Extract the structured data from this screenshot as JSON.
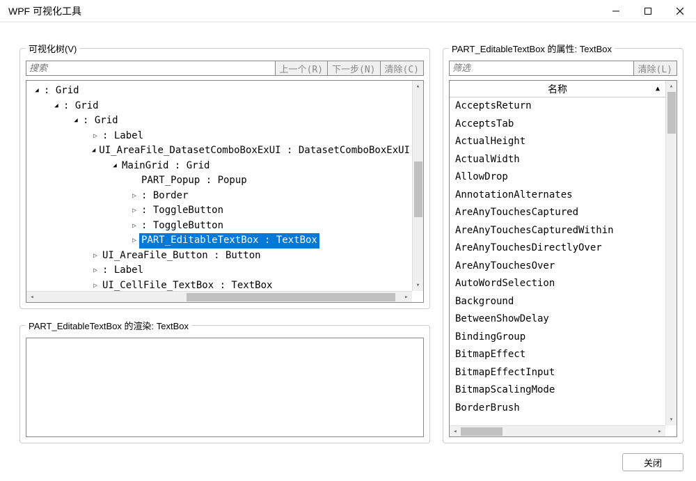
{
  "window": {
    "title": "WPF 可视化工具"
  },
  "left": {
    "tree_legend": "可视化树(V)",
    "search_placeholder": "搜索",
    "prev_label": "上一个(R)",
    "next_label": "下一步(N)",
    "clear_label": "清除(C)",
    "render_legend": "PART_EditableTextBox 的渲染: TextBox"
  },
  "tree": {
    "rows": [
      {
        "depth": 0,
        "arrow": "expanded",
        "text": " : Grid"
      },
      {
        "depth": 1,
        "arrow": "expanded",
        "text": " : Grid"
      },
      {
        "depth": 2,
        "arrow": "expanded",
        "text": " : Grid"
      },
      {
        "depth": 3,
        "arrow": "collapsed",
        "text": " : Label"
      },
      {
        "depth": 3,
        "arrow": "expanded",
        "text": "UI_AreaFile_DatasetComboBoxExUI : DatasetComboBoxExUI"
      },
      {
        "depth": 4,
        "arrow": "expanded",
        "text": "MainGrid : Grid"
      },
      {
        "depth": 5,
        "arrow": "none",
        "text": "PART_Popup : Popup"
      },
      {
        "depth": 5,
        "arrow": "collapsed",
        "text": " : Border"
      },
      {
        "depth": 5,
        "arrow": "collapsed",
        "text": " : ToggleButton"
      },
      {
        "depth": 5,
        "arrow": "collapsed",
        "text": " : ToggleButton"
      },
      {
        "depth": 5,
        "arrow": "collapsed",
        "text": "PART_EditableTextBox : TextBox",
        "selected": true
      },
      {
        "depth": 3,
        "arrow": "collapsed",
        "text": "UI_AreaFile_Button : Button"
      },
      {
        "depth": 3,
        "arrow": "collapsed",
        "text": " : Label"
      },
      {
        "depth": 3,
        "arrow": "collapsed",
        "text": "UI_CellFile_TextBox : TextBox"
      }
    ]
  },
  "right": {
    "legend": "PART_EditableTextBox 的属性: TextBox",
    "filter_placeholder": "筛选",
    "clear_label": "清除(L)",
    "header": "名称"
  },
  "props": [
    "AcceptsReturn",
    "AcceptsTab",
    "ActualHeight",
    "ActualWidth",
    "AllowDrop",
    "AnnotationAlternates",
    "AreAnyTouchesCaptured",
    "AreAnyTouchesCapturedWithin",
    "AreAnyTouchesDirectlyOver",
    "AreAnyTouchesOver",
    "AutoWordSelection",
    "Background",
    "BetweenShowDelay",
    "BindingGroup",
    "BitmapEffect",
    "BitmapEffectInput",
    "BitmapScalingMode",
    "BorderBrush"
  ],
  "footer": {
    "close_label": "关闭"
  }
}
